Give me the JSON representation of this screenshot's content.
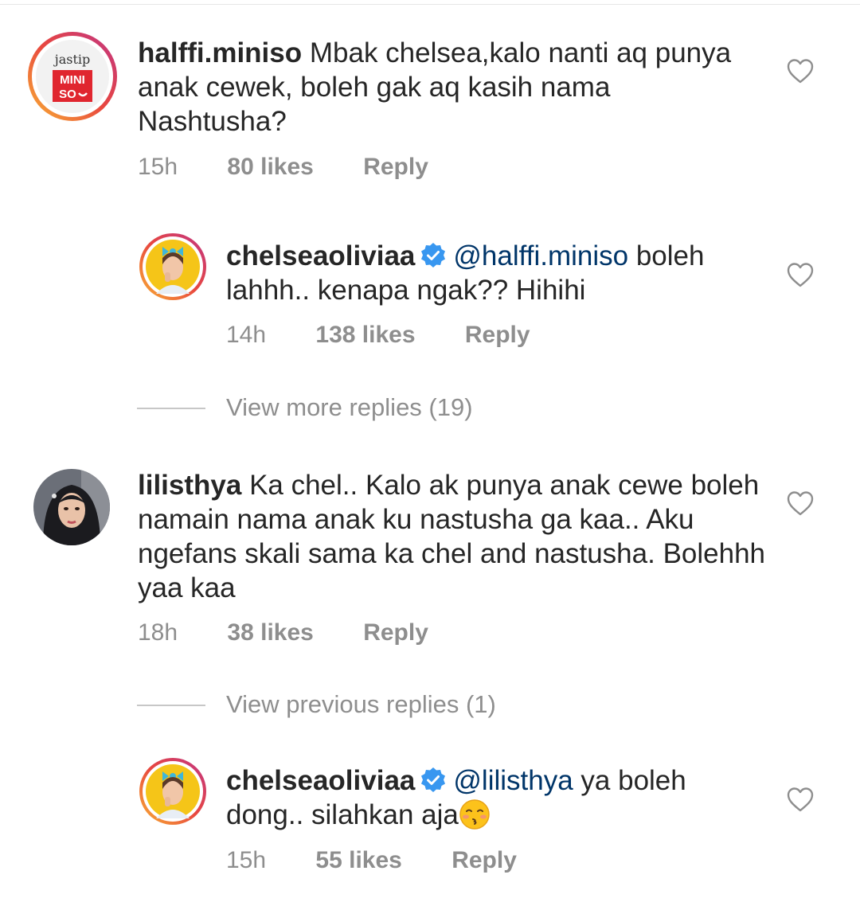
{
  "comments": [
    {
      "username": "halffi.miniso",
      "mention": "",
      "text": "Mbak chelsea,kalo nanti aq punya anak cewek, boleh gak aq kasih nama Nashtusha?",
      "time": "15h",
      "likes": "80 likes",
      "reply": "Reply",
      "avatar_text_top": "jastip",
      "avatar_text_mid": "MINI",
      "avatar_text_bot": "SO"
    },
    {
      "username": "chelseaoliviaa",
      "mention": "@halffi.miniso",
      "text": " boleh lahhh.. kenapa ngak?? Hihihi",
      "time": "14h",
      "likes": "138 likes",
      "reply": "Reply"
    },
    {
      "username": "lilisthya",
      "mention": "",
      "text": "Ka chel.. Kalo ak punya anak cewe boleh namain nama anak ku nastusha ga kaa.. Aku ngefans skali sama ka chel and nastusha. Bolehhh yaa kaa",
      "time": "18h",
      "likes": "38 likes",
      "reply": "Reply"
    },
    {
      "username": "chelseaoliviaa",
      "mention": "@lilisthya",
      "text": " ya boleh dong.. silahkan aja",
      "time": "15h",
      "likes": "55 likes",
      "reply": "Reply"
    }
  ],
  "view_more_replies": "View more replies (19)",
  "view_previous_replies": "View previous replies (1)",
  "icons": {
    "like": "heart-outline-icon",
    "verified": "verified-badge-icon",
    "emoji": "kissing-face-icon"
  },
  "colors": {
    "text": "#262626",
    "muted": "#8e8e8e",
    "mention": "#003569",
    "verified": "#3897f0"
  }
}
